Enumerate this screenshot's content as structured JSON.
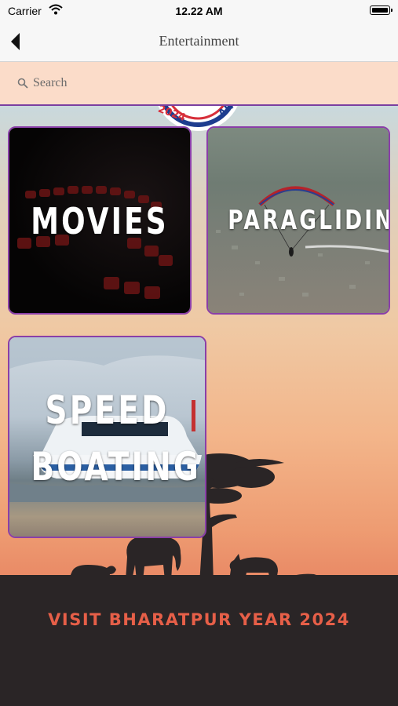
{
  "status_bar": {
    "carrier": "Carrier",
    "time": "12.22 AM"
  },
  "nav": {
    "title": "Entertainment"
  },
  "search": {
    "placeholder": "Search"
  },
  "categories": [
    {
      "label": "MOVIES"
    },
    {
      "label": "PARAGLIDING"
    },
    {
      "label_line1": "SPEED",
      "label_line2": "BOATING"
    }
  ],
  "banner": {
    "text": "VISIT BHARATPUR YEAR 2024",
    "logo_year": "2024"
  },
  "colors": {
    "accent_border": "#8a3fa8",
    "banner_text": "#e65f48",
    "search_bg": "#fbdcc9"
  }
}
